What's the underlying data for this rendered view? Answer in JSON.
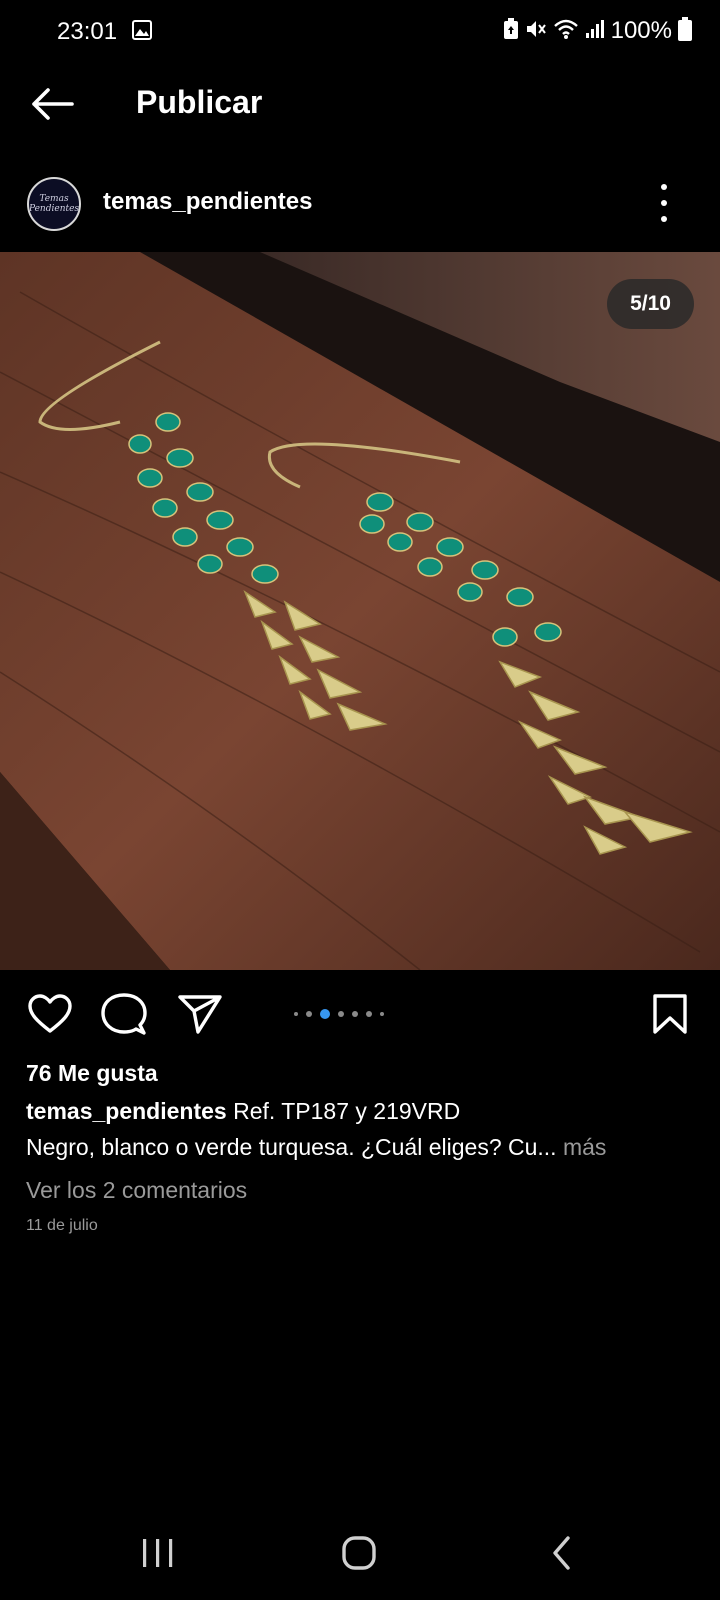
{
  "status_bar": {
    "time": "23:01",
    "battery": "100%",
    "icons": [
      "gallery-icon",
      "battery-saver-icon",
      "mute-icon",
      "wifi-icon",
      "signal-icon",
      "battery-icon"
    ]
  },
  "header": {
    "title": "Publicar",
    "back_icon": "arrow-left-icon"
  },
  "post": {
    "username": "temas_pendientes",
    "avatar_text": "Temas Pendientes",
    "image_counter": "5/10",
    "carousel": {
      "count": 7,
      "active": 2
    },
    "likes": "76 Me gusta",
    "caption_user": "temas_pendientes",
    "caption_text": " Ref. TP187 y 219VRD",
    "caption_line2": "Negro, blanco o verde turquesa. ¿Cuál eliges? Cu...",
    "more_label": " más",
    "comments_link": "Ver los 2 comentarios",
    "date": "11 de julio"
  },
  "colors": {
    "background": "#000000",
    "accent": "#3797f0",
    "muted": "#9a9a9a"
  }
}
